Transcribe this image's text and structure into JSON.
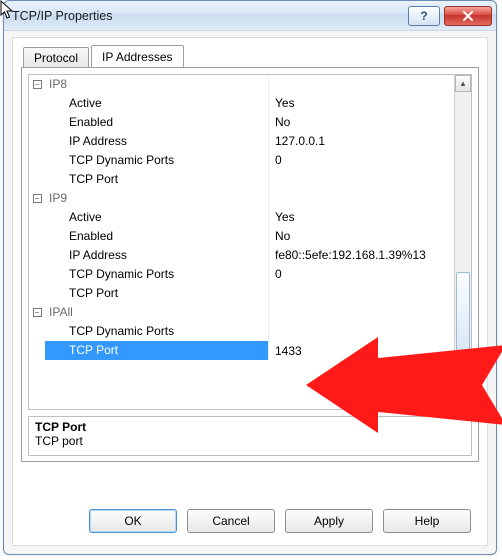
{
  "window": {
    "title": "TCP/IP Properties"
  },
  "tabs": {
    "protocol": "Protocol",
    "ip": "IP Addresses"
  },
  "groups": {
    "ip8": {
      "label": "IP8",
      "active_label": "Active",
      "active_value": "Yes",
      "enabled_label": "Enabled",
      "enabled_value": "No",
      "address_label": "IP Address",
      "address_value": "127.0.0.1",
      "dynports_label": "TCP Dynamic Ports",
      "dynports_value": "0",
      "port_label": "TCP Port",
      "port_value": ""
    },
    "ip9": {
      "label": "IP9",
      "active_label": "Active",
      "active_value": "Yes",
      "enabled_label": "Enabled",
      "enabled_value": "No",
      "address_label": "IP Address",
      "address_value": "fe80::5efe:192.168.1.39%13",
      "dynports_label": "TCP Dynamic Ports",
      "dynports_value": "0",
      "port_label": "TCP Port",
      "port_value": ""
    },
    "ipall": {
      "label": "IPAll",
      "dynports_label": "TCP Dynamic Ports",
      "dynports_value": "",
      "port_label": "TCP Port",
      "port_value": "1433"
    }
  },
  "description": {
    "title": "TCP Port",
    "text": "TCP port"
  },
  "buttons": {
    "ok": "OK",
    "cancel": "Cancel",
    "apply": "Apply",
    "help": "Help"
  }
}
